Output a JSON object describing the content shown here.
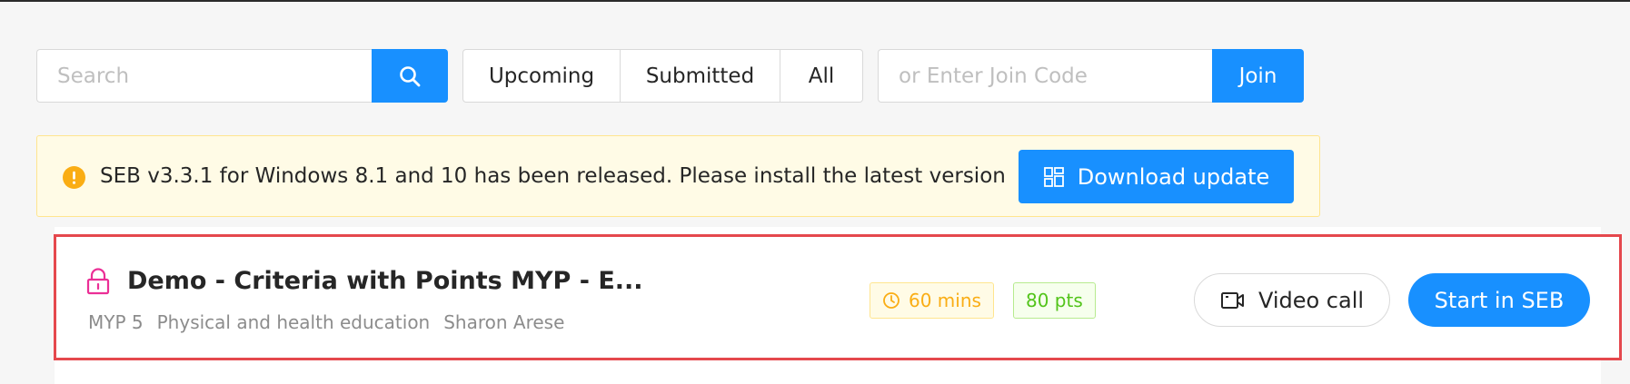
{
  "search": {
    "placeholder": "Search",
    "icon": "search-icon"
  },
  "filters": {
    "upcoming": "Upcoming",
    "submitted": "Submitted",
    "all": "All"
  },
  "join": {
    "placeholder": "or Enter Join Code",
    "button_label": "Join"
  },
  "alert": {
    "icon": "exclamation-circle-icon",
    "message": "SEB v3.3.1 for Windows 8.1 and 10 has been released. Please install the latest version",
    "button_label": "Download update",
    "button_icon": "dashboard-icon"
  },
  "assignment": {
    "lock_icon": "lock-icon",
    "title": "Demo - Criteria with Points MYP - E...",
    "grade": "MYP 5",
    "subject": "Physical and health education",
    "teacher": "Sharon Arese",
    "duration": "60 mins",
    "points": "80 pts",
    "video_call_label": "Video call",
    "start_label": "Start in SEB"
  },
  "colors": {
    "primary": "#1890ff",
    "warning": "#faad14",
    "success": "#52c41a",
    "lock": "#eb2f96",
    "highlight_border": "#e5484d"
  }
}
